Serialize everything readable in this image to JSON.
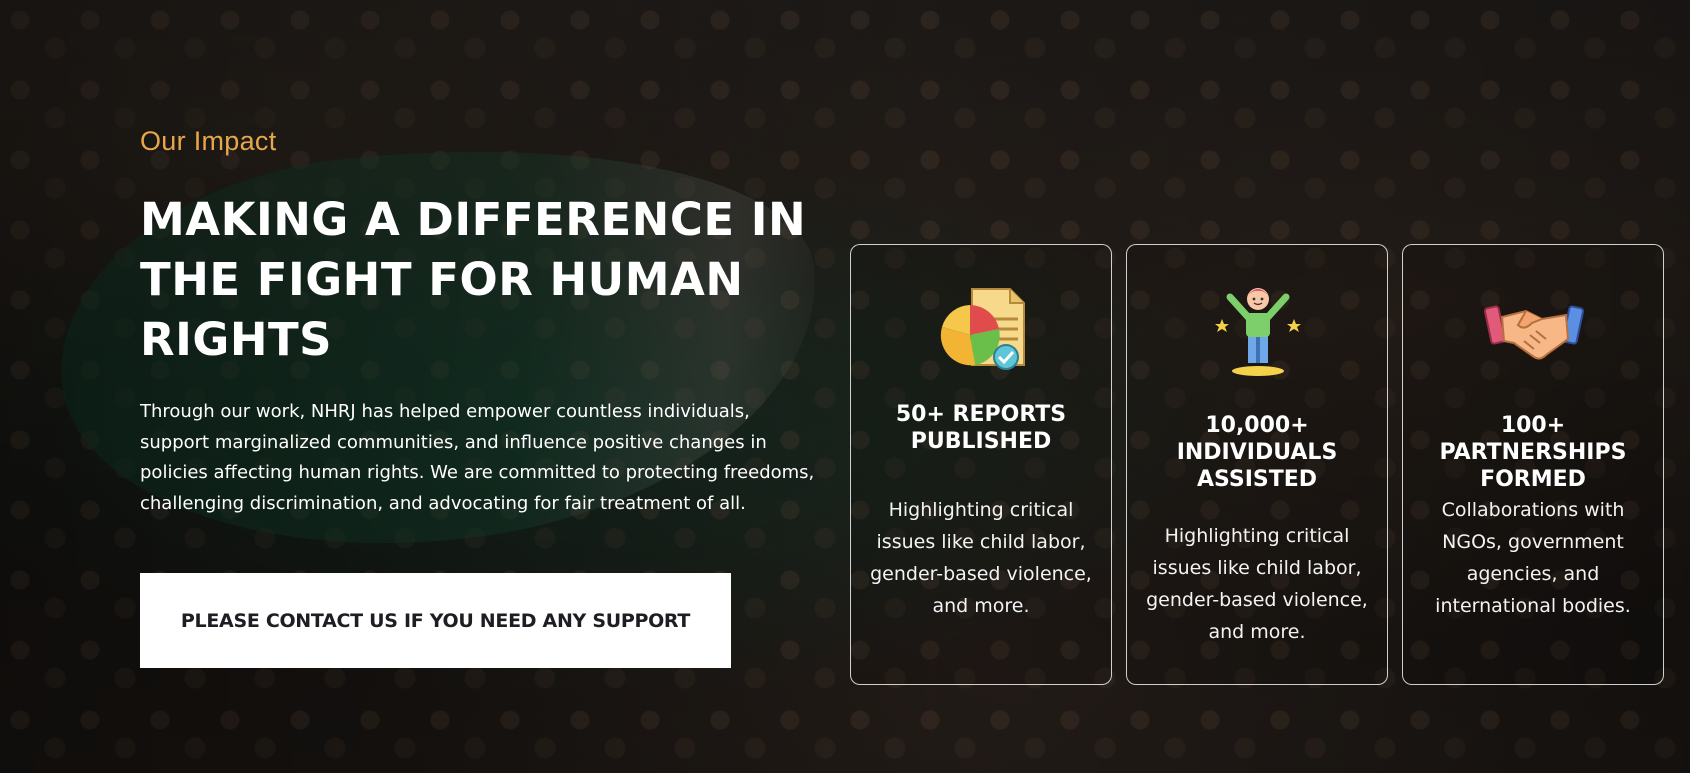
{
  "impact": {
    "eyebrow": "Our Impact",
    "headline": "MAKING A DIFFERENCE IN THE FIGHT FOR HUMAN RIGHTS",
    "body": "Through our work, NHRJ has helped empower countless individuals, support marginalized communities, and influence positive changes in policies affecting human rights. We are committed to protecting freedoms, challenging discrimination, and advocating for fair treatment of all.",
    "cta_label": "PLEASE CONTACT US IF YOU NEED ANY SUPPORT"
  },
  "stats": [
    {
      "icon": "report-chart-icon",
      "title": "50+ REPORTS PUBLISHED",
      "description": "Highlighting critical issues like child labor, gender-based violence, and more."
    },
    {
      "icon": "person-celebrating-icon",
      "title": "10,000+ INDIVIDUALS ASSISTED",
      "description": "Highlighting critical issues like child labor, gender-based violence, and more."
    },
    {
      "icon": "handshake-icon",
      "title": "100+ PARTNERSHIPS FORMED",
      "description": "Collaborations with NGOs, government agencies, and international bodies."
    }
  ],
  "colors": {
    "accent": "#e8a64a",
    "text": "#ffffff",
    "button_bg": "#ffffff",
    "button_text": "#1d1d24"
  }
}
